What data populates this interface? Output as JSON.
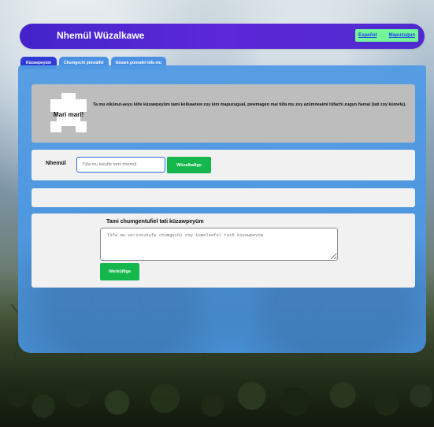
{
  "header": {
    "title": "Nhemül Wüzalkawe",
    "language_links": [
      "Español",
      "Mapuzugun"
    ]
  },
  "tabs": [
    {
      "label": "Küzawpeyüm",
      "active": true
    },
    {
      "label": "Chumgechi pünealfel",
      "active": false
    },
    {
      "label": "Güxam püneafel tüfa mu",
      "active": false
    }
  ],
  "welcome": {
    "badge_text": "Mari mari!",
    "message": "Ta mu elkünut-aeyu kiñe küzawpeyüm tami kelluaetew zoy kim mapuzugual, pewmagen mai tüfa mu zoy azümneaimi tüfachi zugun ñemai (tati zoy kümelu)."
  },
  "name_form": {
    "label": "Nhemül",
    "placeholder": "Tüfa mu tukulfe tami nhemül",
    "button": "Wüzalkafige"
  },
  "comment_form": {
    "title": "Tami chumgentufiel tati küzawpeyüm",
    "placeholder": "Tüfa mu wirintukufe chumgechi zoy kümeleafel taiñ küzawpeyüm",
    "button": "Werkülfige"
  },
  "colors": {
    "header": "#4f2bcf",
    "content_blue": "#4795e2",
    "action_green": "#15b64b",
    "language_bg": "#73f59a",
    "link_blue": "#233cf4",
    "welcome_panel": "#bdbdbd"
  }
}
